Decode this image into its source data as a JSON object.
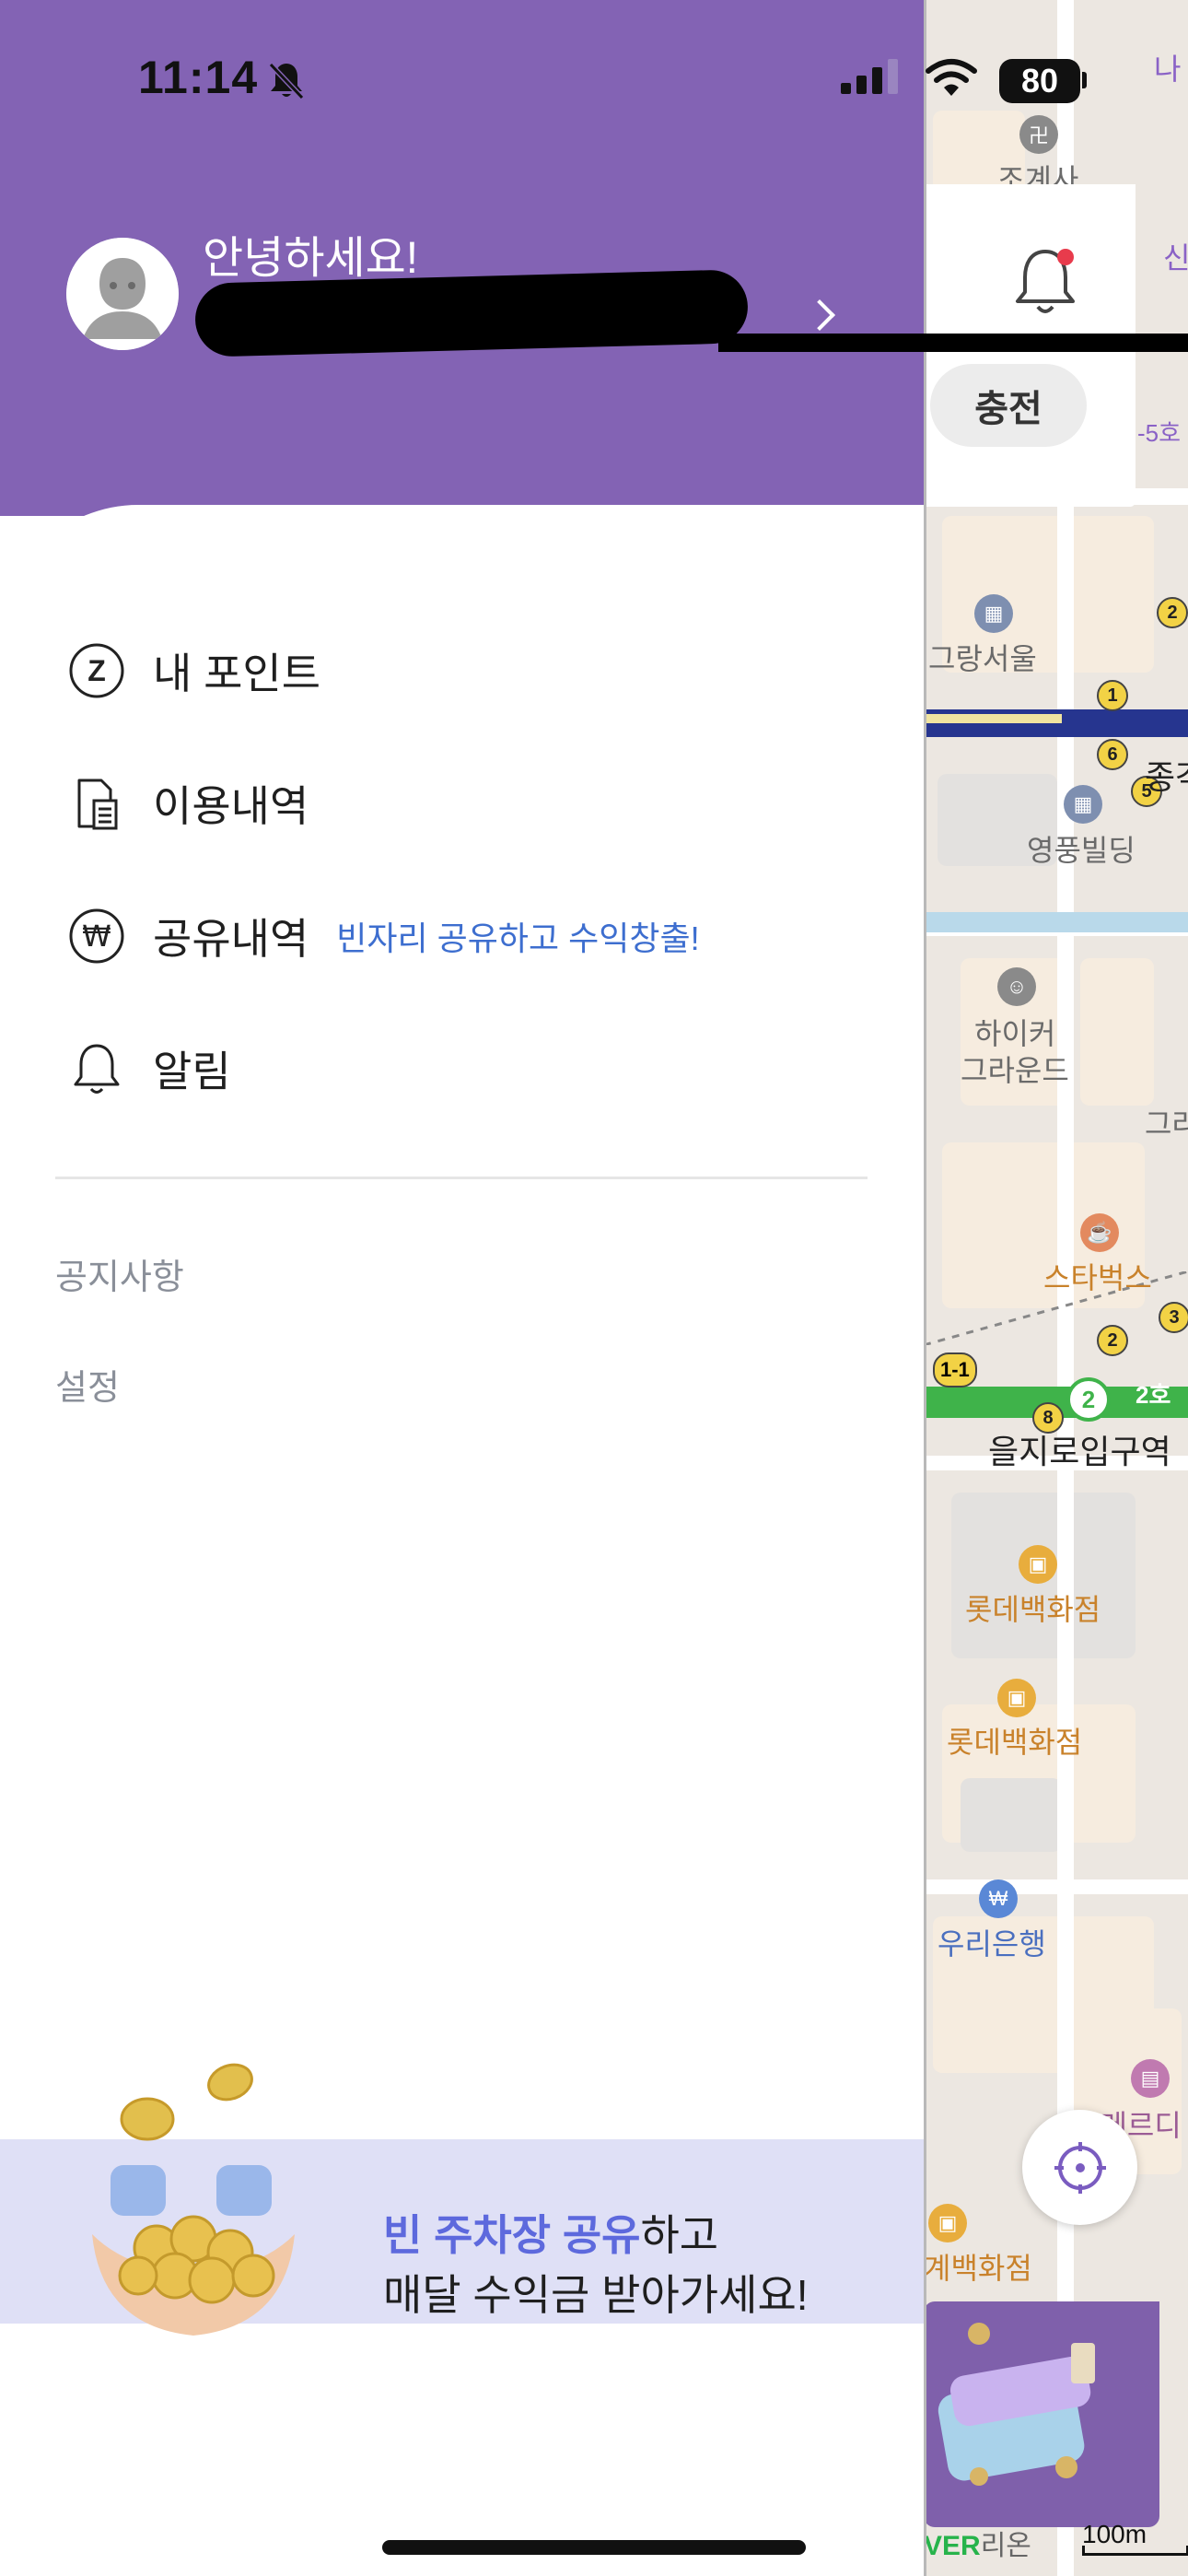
{
  "status_bar": {
    "time": "11:14",
    "battery": "80"
  },
  "profile": {
    "greeting": "안녕하세요!"
  },
  "menu": {
    "items": [
      {
        "label": "내 포인트",
        "icon": "points-icon"
      },
      {
        "label": "이용내역",
        "icon": "receipt-icon"
      },
      {
        "label": "공유내역",
        "icon": "won-icon",
        "sub": "빈자리 공유하고 수익창출!"
      },
      {
        "label": "알림",
        "icon": "bell-icon"
      }
    ],
    "points_icon_letter": "Z",
    "won_icon_symbol": "₩"
  },
  "secondary_links": [
    {
      "label": "공지사항"
    },
    {
      "label": "설정"
    }
  ],
  "banner": {
    "highlight": "빈 주차장 공유",
    "line1_rest": "하고",
    "line2": "매달 수익금 받아가세요!"
  },
  "map": {
    "charge_button": "충전",
    "scale": "100m",
    "provider": "VER",
    "provider_tail": "리온",
    "labels": [
      {
        "text": "나"
      },
      {
        "text": "조계사"
      },
      {
        "text": "신"
      },
      {
        "text": "-5호"
      },
      {
        "text": "그랑서울"
      },
      {
        "text": "종각"
      },
      {
        "text": "영풍빌딩"
      },
      {
        "text": "하이커"
      },
      {
        "text": "그라운드"
      },
      {
        "text": "그라"
      },
      {
        "text": "스타벅스"
      },
      {
        "text": "을지로입구역"
      },
      {
        "text": "롯데백화점"
      },
      {
        "text": "롯데백화점"
      },
      {
        "text": "우리은행"
      },
      {
        "text": "르메르디"
      },
      {
        "text": "계백화점"
      },
      {
        "text": "2호"
      }
    ]
  },
  "colors": {
    "header_purple": "#8363b4",
    "banner_bg": "#dfe0f6",
    "accent_blue": "#3d6ecf",
    "banner_highlight": "#5d69dd"
  }
}
